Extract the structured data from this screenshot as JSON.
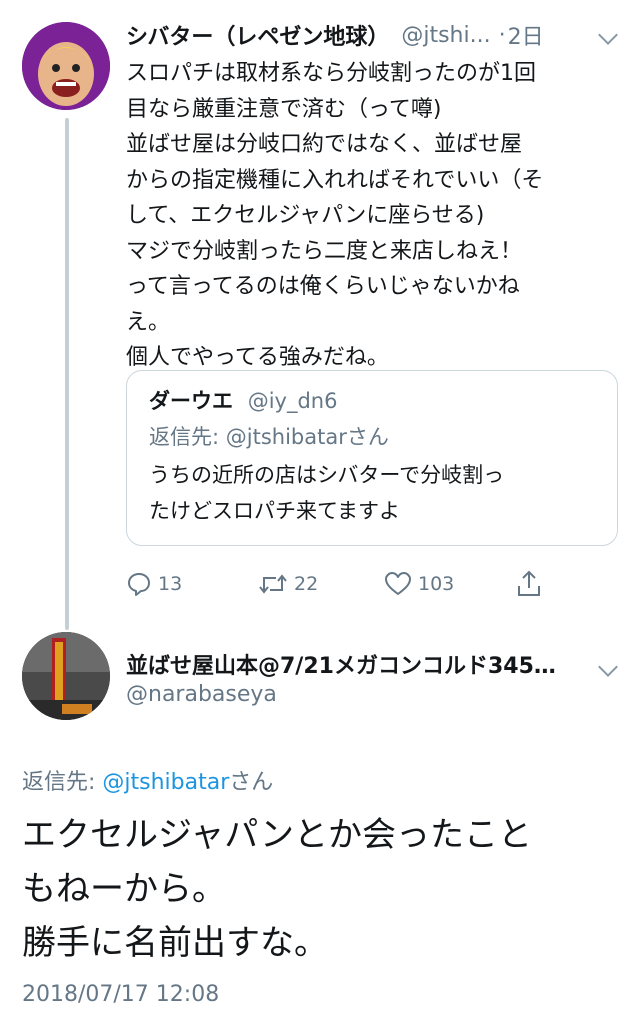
{
  "tweet1": {
    "name": "シバター（レペゼン地球）",
    "handle": "@jtshi...",
    "separator": "·",
    "time": "2日",
    "lines": [
      "スロパチは取材系なら分岐割ったのが1回",
      "目なら厳重注意で済む（って噂)",
      "並ばせ屋は分岐口約ではなく、並ばせ屋",
      "からの指定機種に入れればそれでいい（そ",
      "して、エクセルジャパンに座らせる)",
      "マジで分岐割ったら二度と来店しねえ！",
      "って言ってるのは俺くらいじゃないかね",
      "え。",
      "個人でやってる強みだね。"
    ],
    "quote": {
      "name": "ダーウエ",
      "handle": "@iy_dn6",
      "reply_to": "返信先: @jtshibatarさん",
      "lines": [
        "うちの近所の店はシバターで分岐割っ",
        "たけどスロパチ来てますよ"
      ]
    },
    "actions": {
      "reply_count": "13",
      "retweet_count": "22",
      "like_count": "103"
    }
  },
  "tweet2": {
    "name": "並ばせ屋山本@7/21メガコンコルド345…",
    "handle": "@narabaseya",
    "reply_prefix": "返信先: ",
    "reply_mention": "@jtshibatar",
    "reply_suffix": "さん",
    "lines": [
      "エクセルジャパンとか会ったこと",
      "もねーから。",
      "勝手に名前出すな。"
    ],
    "timestamp": "2018/07/17 12:08"
  },
  "colors": {
    "secondary_text": "#657786",
    "link": "#1b95e0",
    "thread_line": "#c4cfd6",
    "border": "#ccd6dd"
  }
}
